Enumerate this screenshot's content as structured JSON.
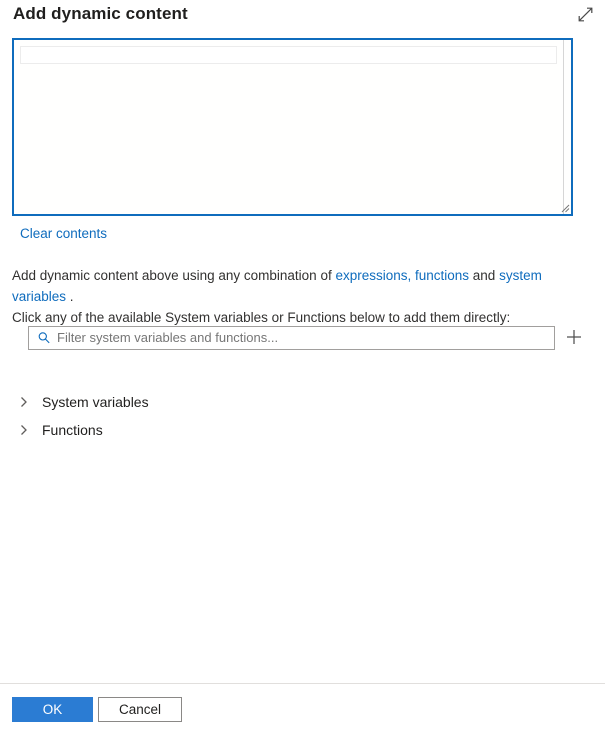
{
  "panel": {
    "title": "Add dynamic content",
    "expand_icon": "expand-diagonal-icon"
  },
  "editor": {
    "value": "",
    "clear_label": "Clear contents",
    "resize_icon": "resize-grip-icon"
  },
  "description": {
    "line1_prefix": "Add dynamic content above using any combination of ",
    "link_expressions": "expressions, functions",
    "line1_mid": " and ",
    "link_system_variables": "system variables",
    "line1_suffix": " .",
    "line2": "Click any of the available System variables or Functions below to add them directly:"
  },
  "filter": {
    "placeholder": "Filter system variables and functions...",
    "value": "",
    "search_icon": "search-icon",
    "add_icon": "plus-icon"
  },
  "sections": [
    {
      "label": "System variables",
      "icon": "chevron-right-icon",
      "expanded": false
    },
    {
      "label": "Functions",
      "icon": "chevron-right-icon",
      "expanded": false
    }
  ],
  "footer": {
    "ok_label": "OK",
    "cancel_label": "Cancel"
  },
  "colors": {
    "accent": "#0f6cbd",
    "primary_button": "#2b7cd3",
    "link": "#0f6cbd",
    "focus_border": "#0f6cbd",
    "text": "#323130",
    "separator": "#e1dfdd"
  }
}
